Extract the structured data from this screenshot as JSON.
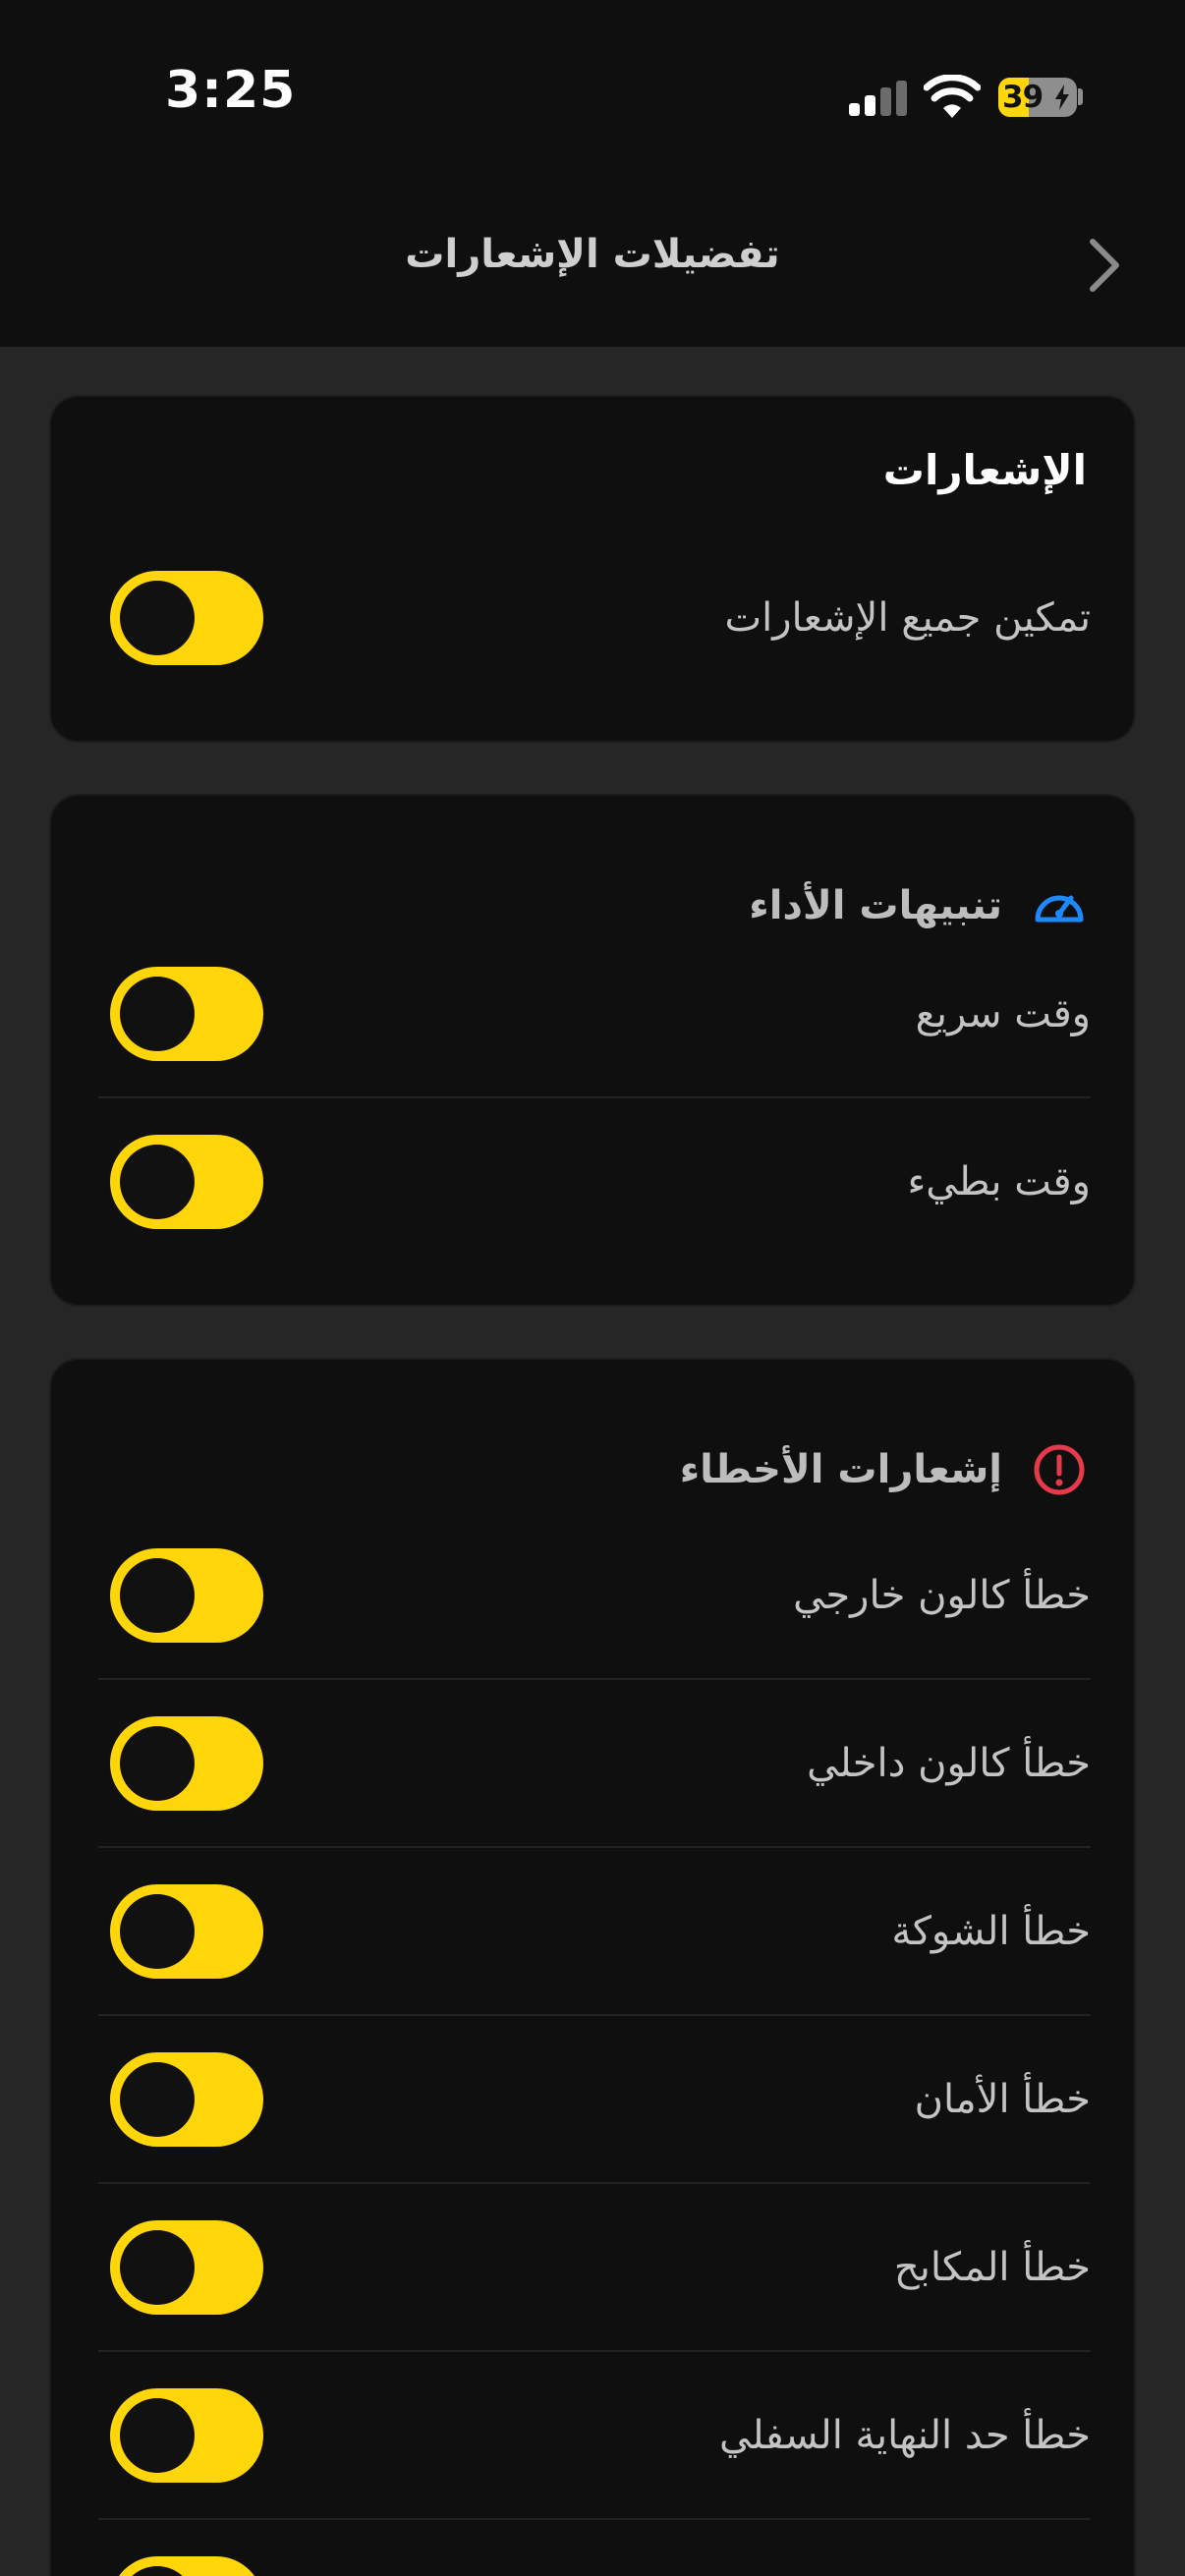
{
  "status_bar": {
    "time": "3:25",
    "battery": "39",
    "battery_level": 0.39
  },
  "header": {
    "title": "تفضيلات الإشعارات",
    "back_icon": "chevron-right-icon"
  },
  "notifications": {
    "title": "الإشعارات",
    "enable_all_label": "تمكين جميع الإشعارات",
    "enable_all_on": true
  },
  "performance": {
    "title": "تنبيهات الأداء",
    "icon": "speedometer-icon",
    "icon_color": "#1e88ff",
    "items": [
      {
        "label": "وقت سريع",
        "on": true
      },
      {
        "label": "وقت بطيء",
        "on": true
      }
    ]
  },
  "errors": {
    "title": "إشعارات الأخطاء",
    "icon": "alert-circle-icon",
    "icon_color": "#e53a4a",
    "items": [
      {
        "label": "خطأ كالون خارجي",
        "on": true
      },
      {
        "label": "خطأ كالون داخلي",
        "on": true
      },
      {
        "label": "خطأ الشوكة",
        "on": true
      },
      {
        "label": "خطأ الأمان",
        "on": true
      },
      {
        "label": "خطأ المكابح",
        "on": true
      },
      {
        "label": "خطأ حد النهاية السفلي",
        "on": true
      },
      {
        "label": "",
        "on": true
      }
    ]
  },
  "colors": {
    "accent": "#ffd60a",
    "background": "#262626",
    "card": "#0f0f0f"
  }
}
